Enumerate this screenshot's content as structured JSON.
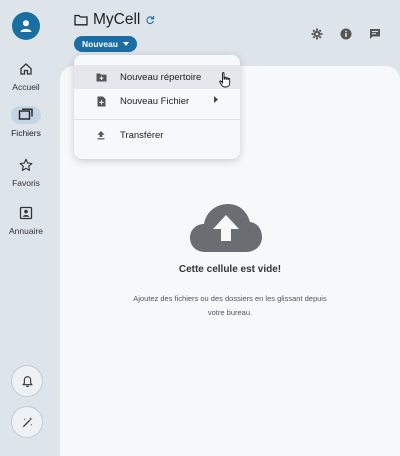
{
  "app": {
    "folder_name": "MyCell",
    "new_button_label": "Nouveau"
  },
  "sidebar": {
    "items": [
      {
        "label": "Accueil",
        "icon": "home-icon",
        "active": false
      },
      {
        "label": "Fichiers",
        "icon": "folders-icon",
        "active": true
      },
      {
        "label": "Favoris",
        "icon": "star-icon",
        "active": false
      },
      {
        "label": "Annuaire",
        "icon": "contacts-icon",
        "active": false
      }
    ],
    "bottom_buttons": [
      "bell-icon",
      "magic-wand-icon"
    ]
  },
  "header": {
    "actions": [
      "gear-icon",
      "info-icon",
      "chat-icon"
    ]
  },
  "menu": {
    "items": [
      {
        "label": "Nouveau répertoire",
        "icon": "folder-plus-icon"
      },
      {
        "label": "Nouveau Fichier",
        "icon": "file-plus-icon",
        "has_submenu": true
      },
      {
        "label": "Transférer",
        "icon": "upload-icon"
      }
    ]
  },
  "empty_state": {
    "title": "Cette cellule est vide!",
    "text": "Ajoutez des fichiers ou des dossiers en les glissant depuis votre bureau."
  },
  "colors": {
    "accent": "#1b6ea3",
    "background": "#dde4ea",
    "panel": "#f6f8fa",
    "icon": "#6b7075"
  }
}
